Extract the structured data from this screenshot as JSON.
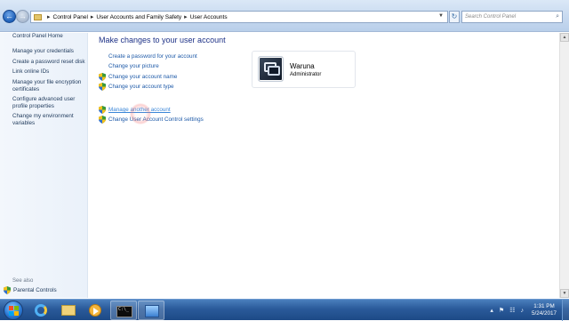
{
  "address_bar": {
    "crumbs": [
      "Control Panel",
      "User Accounts and Family Safety",
      "User Accounts"
    ],
    "search_placeholder": "Search Control Panel"
  },
  "left_pane": {
    "home_link": "Control Panel Home",
    "links": [
      "Manage your credentials",
      "Create a password reset disk",
      "Link online IDs",
      "Manage your file encryption certificates",
      "Configure advanced user profile properties",
      "Change my environment variables"
    ],
    "see_also_heading": "See also",
    "see_also_items": [
      "Parental Controls"
    ]
  },
  "main": {
    "title": "Make changes to your user account",
    "tasks": [
      {
        "label": "Create a password for your account",
        "shield": false
      },
      {
        "label": "Change your picture",
        "shield": false
      },
      {
        "label": "Change your account name",
        "shield": true
      },
      {
        "label": "Change your account type",
        "shield": true
      }
    ],
    "other_tasks": [
      {
        "label": "Manage another account",
        "shield": true
      },
      {
        "label": "Change User Account Control settings",
        "shield": true
      }
    ]
  },
  "account_card": {
    "name": "Waruna",
    "role": "Administrator",
    "avatar_icon": "windows-user-tile-icon"
  },
  "taskbar": {
    "pinned": [
      "internet-explorer-icon",
      "windows-explorer-icon",
      "media-player-icon",
      "command-prompt-icon",
      "control-panel-icon"
    ],
    "active_item": "control-panel-icon",
    "clock_time": "1:31 PM",
    "clock_date": "5/24/2017"
  },
  "colors": {
    "link": "#1e5aa8",
    "title": "#1e3287",
    "taskbar": "#2a5a9a"
  }
}
